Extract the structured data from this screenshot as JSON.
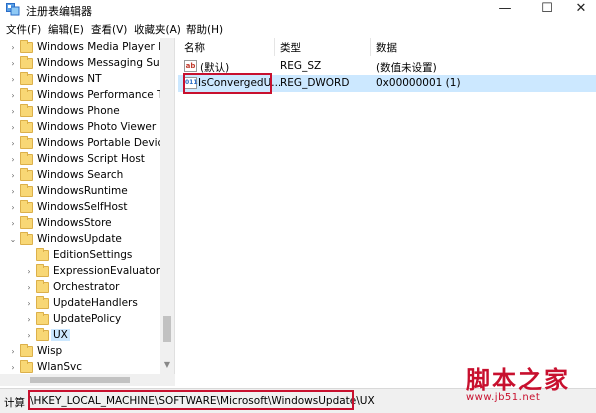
{
  "window": {
    "title": "注册表编辑器",
    "controls": {
      "minimize": "—",
      "maximize": "☐",
      "close": "✕"
    }
  },
  "menu": [
    "文件(F)",
    "编辑(E)",
    "查看(V)",
    "收藏夹(A)",
    "帮助(H)"
  ],
  "tree": {
    "items": [
      {
        "label": "Windows Media Player NS",
        "expander": "›"
      },
      {
        "label": "Windows Messaging Subs",
        "expander": "›"
      },
      {
        "label": "Windows NT",
        "expander": "›"
      },
      {
        "label": "Windows Performance Too",
        "expander": "›"
      },
      {
        "label": "Windows Phone",
        "expander": "›"
      },
      {
        "label": "Windows Photo Viewer",
        "expander": "›"
      },
      {
        "label": "Windows Portable Devices",
        "expander": "›"
      },
      {
        "label": "Windows Script Host",
        "expander": "›"
      },
      {
        "label": "Windows Search",
        "expander": "›"
      },
      {
        "label": "WindowsRuntime",
        "expander": "›"
      },
      {
        "label": "WindowsSelfHost",
        "expander": "›"
      },
      {
        "label": "WindowsStore",
        "expander": "›"
      },
      {
        "label": "WindowsUpdate",
        "expander": "⌄"
      },
      {
        "label": "EditionSettings",
        "expander": ""
      },
      {
        "label": "ExpressionEvaluators",
        "expander": "›"
      },
      {
        "label": "Orchestrator",
        "expander": "›"
      },
      {
        "label": "UpdateHandlers",
        "expander": "›"
      },
      {
        "label": "UpdatePolicy",
        "expander": "›"
      },
      {
        "label": "UX",
        "expander": "›"
      },
      {
        "label": "Wisp",
        "expander": "›"
      },
      {
        "label": "WlanSvc",
        "expander": "›"
      }
    ]
  },
  "list": {
    "headers": {
      "name": "名称",
      "type": "类型",
      "data": "数据"
    },
    "rows": [
      {
        "icon": "ab",
        "name": "(默认)",
        "type": "REG_SZ",
        "data": "(数值未设置)"
      },
      {
        "icon": "011",
        "name": "IsConvergedU...",
        "type": "REG_DWORD",
        "data": "0x00000001 (1)"
      }
    ]
  },
  "status": {
    "label": "计算",
    "path": "\\HKEY_LOCAL_MACHINE\\SOFTWARE\\Microsoft\\WindowsUpdate\\UX"
  },
  "watermark": {
    "top": "脚本之家",
    "bottom": "www.jb51.net"
  },
  "colors": {
    "accent": "#c8102e",
    "selection": "#cce8ff",
    "folder": "#f8d775"
  }
}
